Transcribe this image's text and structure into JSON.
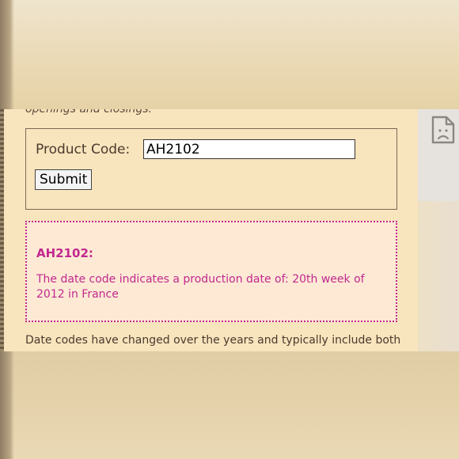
{
  "intro": {
    "truncated_text": "openings and closings."
  },
  "form": {
    "product_code_label": "Product Code:",
    "product_code_value": "AH2102",
    "submit_label": "Submit"
  },
  "result": {
    "title": "AH2102:",
    "text": "The date code indicates a production date of: 20th week of 2012 in France"
  },
  "body": {
    "paragraph": "Date codes have changed over the years and typically include both"
  },
  "side_panel": {
    "icon": "broken-image-icon"
  },
  "colors": {
    "page_background": "#f8e4bd",
    "accent": "#c2288f",
    "text": "#4a3b2d"
  }
}
